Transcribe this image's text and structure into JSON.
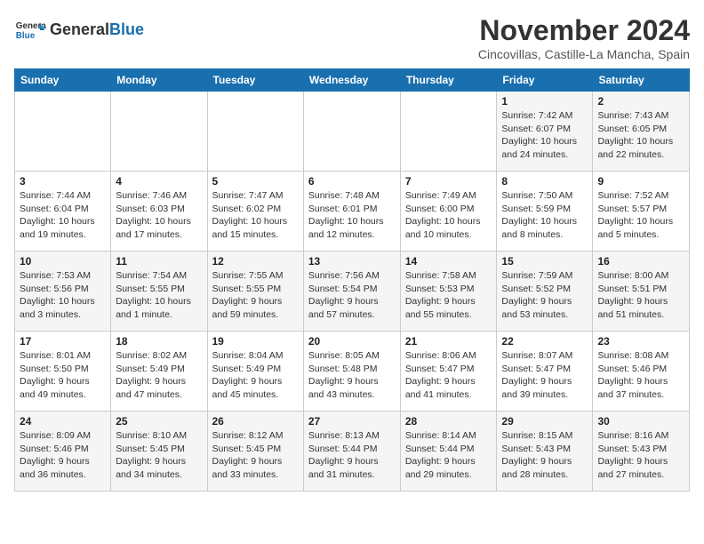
{
  "header": {
    "logo_general": "General",
    "logo_blue": "Blue",
    "month": "November 2024",
    "location": "Cincovillas, Castille-La Mancha, Spain"
  },
  "weekdays": [
    "Sunday",
    "Monday",
    "Tuesday",
    "Wednesday",
    "Thursday",
    "Friday",
    "Saturday"
  ],
  "weeks": [
    [
      {
        "day": "",
        "info": ""
      },
      {
        "day": "",
        "info": ""
      },
      {
        "day": "",
        "info": ""
      },
      {
        "day": "",
        "info": ""
      },
      {
        "day": "",
        "info": ""
      },
      {
        "day": "1",
        "info": "Sunrise: 7:42 AM\nSunset: 6:07 PM\nDaylight: 10 hours and 24 minutes."
      },
      {
        "day": "2",
        "info": "Sunrise: 7:43 AM\nSunset: 6:05 PM\nDaylight: 10 hours and 22 minutes."
      }
    ],
    [
      {
        "day": "3",
        "info": "Sunrise: 7:44 AM\nSunset: 6:04 PM\nDaylight: 10 hours and 19 minutes."
      },
      {
        "day": "4",
        "info": "Sunrise: 7:46 AM\nSunset: 6:03 PM\nDaylight: 10 hours and 17 minutes."
      },
      {
        "day": "5",
        "info": "Sunrise: 7:47 AM\nSunset: 6:02 PM\nDaylight: 10 hours and 15 minutes."
      },
      {
        "day": "6",
        "info": "Sunrise: 7:48 AM\nSunset: 6:01 PM\nDaylight: 10 hours and 12 minutes."
      },
      {
        "day": "7",
        "info": "Sunrise: 7:49 AM\nSunset: 6:00 PM\nDaylight: 10 hours and 10 minutes."
      },
      {
        "day": "8",
        "info": "Sunrise: 7:50 AM\nSunset: 5:59 PM\nDaylight: 10 hours and 8 minutes."
      },
      {
        "day": "9",
        "info": "Sunrise: 7:52 AM\nSunset: 5:57 PM\nDaylight: 10 hours and 5 minutes."
      }
    ],
    [
      {
        "day": "10",
        "info": "Sunrise: 7:53 AM\nSunset: 5:56 PM\nDaylight: 10 hours and 3 minutes."
      },
      {
        "day": "11",
        "info": "Sunrise: 7:54 AM\nSunset: 5:55 PM\nDaylight: 10 hours and 1 minute."
      },
      {
        "day": "12",
        "info": "Sunrise: 7:55 AM\nSunset: 5:55 PM\nDaylight: 9 hours and 59 minutes."
      },
      {
        "day": "13",
        "info": "Sunrise: 7:56 AM\nSunset: 5:54 PM\nDaylight: 9 hours and 57 minutes."
      },
      {
        "day": "14",
        "info": "Sunrise: 7:58 AM\nSunset: 5:53 PM\nDaylight: 9 hours and 55 minutes."
      },
      {
        "day": "15",
        "info": "Sunrise: 7:59 AM\nSunset: 5:52 PM\nDaylight: 9 hours and 53 minutes."
      },
      {
        "day": "16",
        "info": "Sunrise: 8:00 AM\nSunset: 5:51 PM\nDaylight: 9 hours and 51 minutes."
      }
    ],
    [
      {
        "day": "17",
        "info": "Sunrise: 8:01 AM\nSunset: 5:50 PM\nDaylight: 9 hours and 49 minutes."
      },
      {
        "day": "18",
        "info": "Sunrise: 8:02 AM\nSunset: 5:49 PM\nDaylight: 9 hours and 47 minutes."
      },
      {
        "day": "19",
        "info": "Sunrise: 8:04 AM\nSunset: 5:49 PM\nDaylight: 9 hours and 45 minutes."
      },
      {
        "day": "20",
        "info": "Sunrise: 8:05 AM\nSunset: 5:48 PM\nDaylight: 9 hours and 43 minutes."
      },
      {
        "day": "21",
        "info": "Sunrise: 8:06 AM\nSunset: 5:47 PM\nDaylight: 9 hours and 41 minutes."
      },
      {
        "day": "22",
        "info": "Sunrise: 8:07 AM\nSunset: 5:47 PM\nDaylight: 9 hours and 39 minutes."
      },
      {
        "day": "23",
        "info": "Sunrise: 8:08 AM\nSunset: 5:46 PM\nDaylight: 9 hours and 37 minutes."
      }
    ],
    [
      {
        "day": "24",
        "info": "Sunrise: 8:09 AM\nSunset: 5:46 PM\nDaylight: 9 hours and 36 minutes."
      },
      {
        "day": "25",
        "info": "Sunrise: 8:10 AM\nSunset: 5:45 PM\nDaylight: 9 hours and 34 minutes."
      },
      {
        "day": "26",
        "info": "Sunrise: 8:12 AM\nSunset: 5:45 PM\nDaylight: 9 hours and 33 minutes."
      },
      {
        "day": "27",
        "info": "Sunrise: 8:13 AM\nSunset: 5:44 PM\nDaylight: 9 hours and 31 minutes."
      },
      {
        "day": "28",
        "info": "Sunrise: 8:14 AM\nSunset: 5:44 PM\nDaylight: 9 hours and 29 minutes."
      },
      {
        "day": "29",
        "info": "Sunrise: 8:15 AM\nSunset: 5:43 PM\nDaylight: 9 hours and 28 minutes."
      },
      {
        "day": "30",
        "info": "Sunrise: 8:16 AM\nSunset: 5:43 PM\nDaylight: 9 hours and 27 minutes."
      }
    ]
  ]
}
